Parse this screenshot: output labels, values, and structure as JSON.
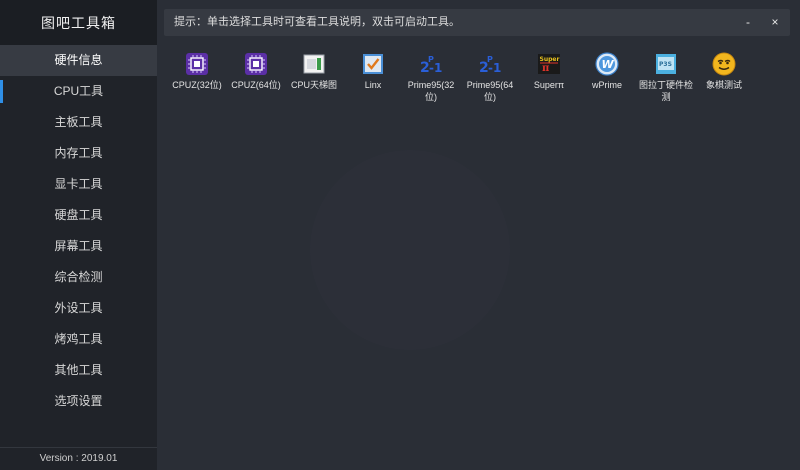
{
  "app": {
    "title": "图吧工具箱",
    "version": "Version : 2019.01"
  },
  "hint": "提示：单击选择工具时可查看工具说明，双击可启动工具。",
  "window": {
    "minimize": "-",
    "close": "×"
  },
  "sidebar": {
    "items": [
      {
        "label": "硬件信息"
      },
      {
        "label": "CPU工具"
      },
      {
        "label": "主板工具"
      },
      {
        "label": "内存工具"
      },
      {
        "label": "显卡工具"
      },
      {
        "label": "硬盘工具"
      },
      {
        "label": "屏幕工具"
      },
      {
        "label": "综合检测"
      },
      {
        "label": "外设工具"
      },
      {
        "label": "烤鸡工具"
      },
      {
        "label": "其他工具"
      },
      {
        "label": "选项设置"
      }
    ]
  },
  "tools": [
    {
      "label": "CPUZ(32位)",
      "icon": "cpuz-chip-icon"
    },
    {
      "label": "CPUZ(64位)",
      "icon": "cpuz-chip-icon"
    },
    {
      "label": "CPU天梯图",
      "icon": "ladder-chart-icon"
    },
    {
      "label": "Linx",
      "icon": "checkmark-box-icon"
    },
    {
      "label": "Prime95(32位)",
      "icon": "prime95-icon"
    },
    {
      "label": "Prime95(64位)",
      "icon": "prime95-icon"
    },
    {
      "label": "Superπ",
      "icon": "superpi-icon"
    },
    {
      "label": "wPrime",
      "icon": "wprime-w-icon"
    },
    {
      "label": "图拉丁硬件检测",
      "icon": "tuladin-p3s-icon"
    },
    {
      "label": "象棋测试",
      "icon": "smiley-face-icon"
    }
  ],
  "colors": {
    "sidebar_bg": "#202329",
    "main_bg": "#2a2e36",
    "accent": "#2f8fe6",
    "active_item_bg": "#373b43"
  }
}
